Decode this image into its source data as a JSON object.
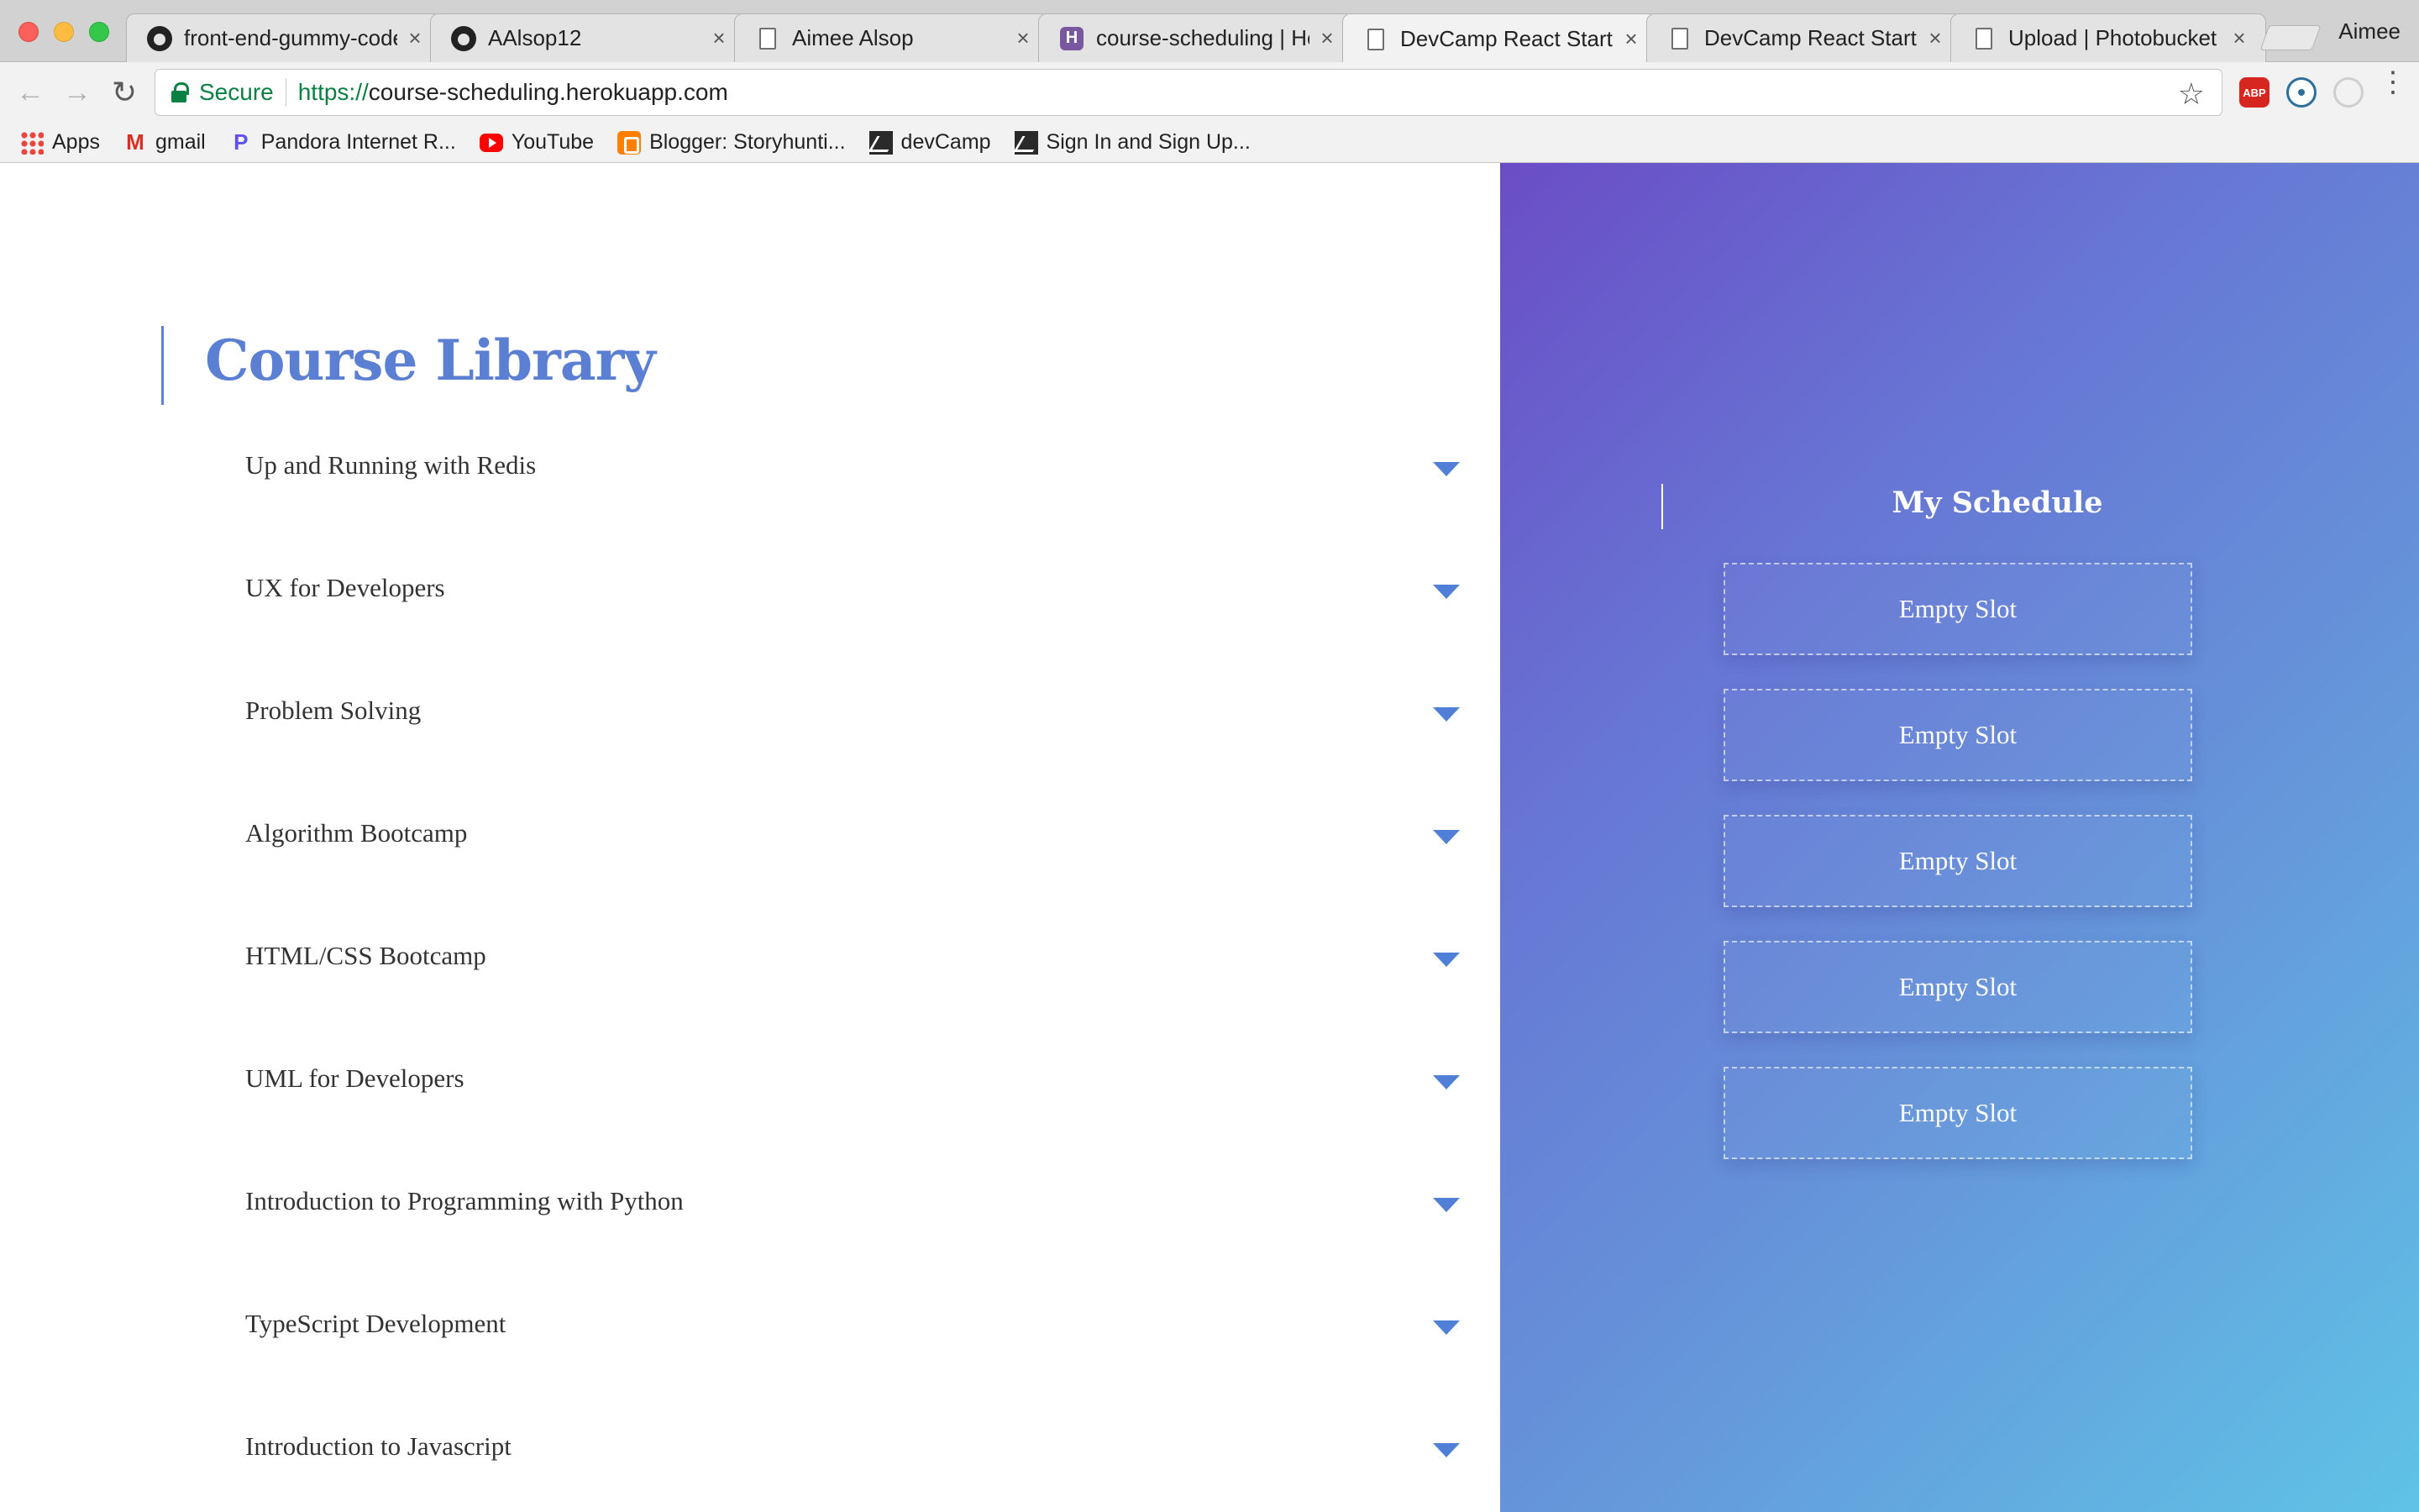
{
  "browser": {
    "tabs": [
      {
        "title": "front-end-gummy-code",
        "icon": "github-icon"
      },
      {
        "title": "AAlsop12",
        "icon": "github-icon"
      },
      {
        "title": "Aimee Alsop",
        "icon": "document-icon"
      },
      {
        "title": "course-scheduling | Heroku",
        "icon": "heroku-icon"
      },
      {
        "title": "DevCamp React Starter",
        "icon": "document-icon",
        "active": true
      },
      {
        "title": "DevCamp React Starter",
        "icon": "document-icon"
      },
      {
        "title": "Upload | Photobucket",
        "icon": "document-icon"
      }
    ],
    "profile_name": "Aimee",
    "address": {
      "secure_label": "Secure",
      "scheme": "https://",
      "host": "course-scheduling.herokuapp.com"
    },
    "bookmarks": [
      {
        "label": "Apps",
        "icon": "apps-grid-icon"
      },
      {
        "label": "gmail",
        "icon": "gmail-icon"
      },
      {
        "label": "Pandora Internet R...",
        "icon": "pandora-icon"
      },
      {
        "label": "YouTube",
        "icon": "youtube-icon"
      },
      {
        "label": "Blogger: Storyhunti...",
        "icon": "blogger-icon"
      },
      {
        "label": "devCamp",
        "icon": "devcamp-icon"
      },
      {
        "label": "Sign In and Sign Up...",
        "icon": "devcamp-icon"
      }
    ],
    "extensions": {
      "abp_label": "ABP"
    }
  },
  "library": {
    "title": "Course Library",
    "courses": [
      "Up and Running with Redis",
      "UX for Developers",
      "Problem Solving",
      "Algorithm Bootcamp",
      "HTML/CSS Bootcamp",
      "UML for Developers",
      "Introduction to Programming with Python",
      "TypeScript Development",
      "Introduction to Javascript"
    ]
  },
  "schedule": {
    "title": "My Schedule",
    "slots": [
      "Empty Slot",
      "Empty Slot",
      "Empty Slot",
      "Empty Slot",
      "Empty Slot"
    ]
  },
  "colors": {
    "accent_blue": "#5b7fd3",
    "gradient_start": "#6a4dc6",
    "gradient_end": "#5fc3e6"
  }
}
